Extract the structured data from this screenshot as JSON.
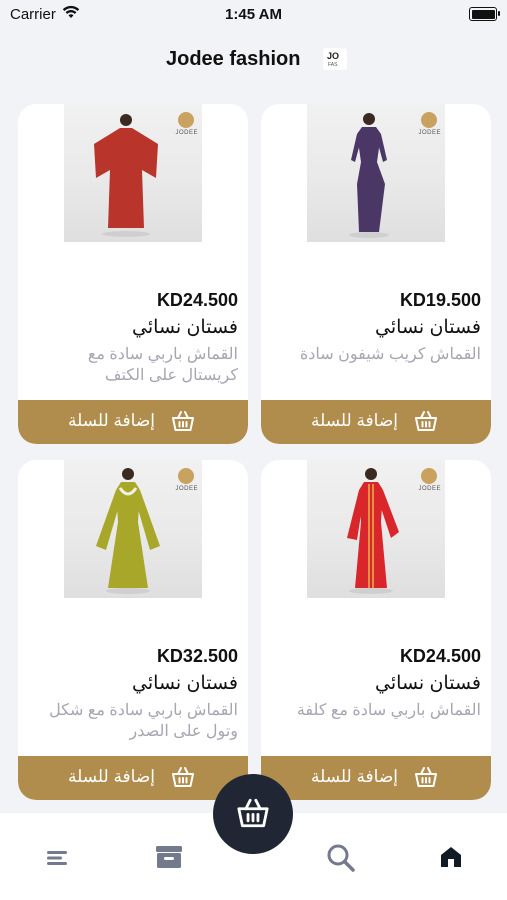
{
  "status_bar": {
    "carrier": "Carrier",
    "time": "1:45 AM"
  },
  "header": {
    "title": "Jodee fashion",
    "logo_text": "JO\nFAS"
  },
  "products": [
    {
      "price": "KD24.500",
      "name": "فستان نسائي",
      "description": "القماش باربي سادة مع كريستال على الكتف",
      "add_label": "إضافة للسلة",
      "brand": "JODEE",
      "dress_color": "#b9352c"
    },
    {
      "price": "KD19.500",
      "name": "فستان نسائي",
      "description": "القماش كريب شيفون سادة",
      "add_label": "إضافة للسلة",
      "brand": "JODEE",
      "dress_color": "#4b3766"
    },
    {
      "price": "KD32.500",
      "name": "فستان نسائي",
      "description": "القماش باربي سادة مع شكل وتول على الصدر",
      "add_label": "إضافة للسلة",
      "brand": "JODEE",
      "dress_color": "#a8a72a"
    },
    {
      "price": "KD24.500",
      "name": "فستان نسائي",
      "description": "القماش باربي سادة مع كلفة",
      "add_label": "إضافة للسلة",
      "brand": "JODEE",
      "dress_color": "#d8262b"
    }
  ],
  "tabs": [
    {
      "icon": "menu-icon"
    },
    {
      "icon": "storefront-icon"
    },
    {
      "icon": "search-icon"
    },
    {
      "icon": "home-icon"
    }
  ],
  "fab": {
    "icon": "basket-icon"
  },
  "colors": {
    "accent": "#b08d4c",
    "fab": "#202633",
    "background": "#f2f3f7"
  }
}
